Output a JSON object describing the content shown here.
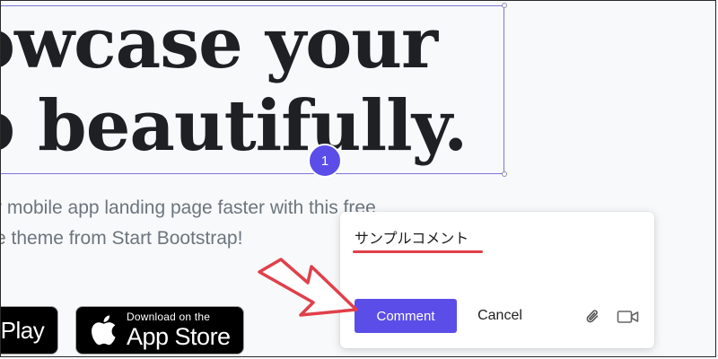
{
  "hero": {
    "headline_line1": "owcase your",
    "headline_line2": "o beautifully.",
    "subtext_line1": "r mobile app landing page faster with this free",
    "subtext_line2": "e theme from Start Bootstrap!",
    "marker_number": "1"
  },
  "badges": {
    "google_main": "e Play",
    "apple_small": "Download on the",
    "apple_large": "App Store"
  },
  "comment": {
    "input_value": "サンプルコメント",
    "submit_label": "Comment",
    "cancel_label": "Cancel",
    "attach_icon": "paperclip-icon",
    "video_icon": "video-camera-icon"
  },
  "colors": {
    "accent": "#5b4ee8",
    "annotation_red": "#e0404a"
  }
}
